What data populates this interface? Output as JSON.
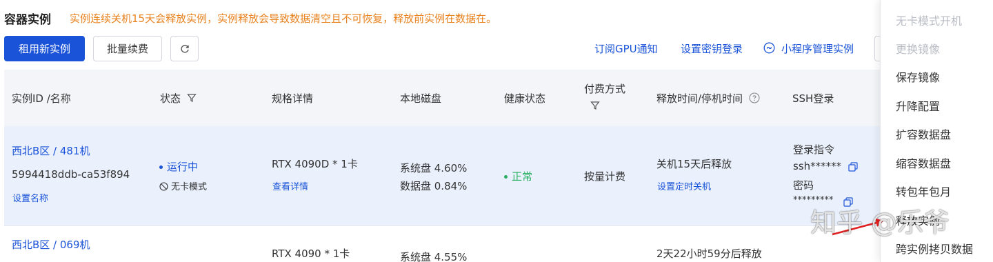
{
  "header": {
    "title": "容器实例",
    "notice": "实例连续关机15天会释放实例，实例释放会导致数据清空且不可恢复，释放前实例在数据在。"
  },
  "toolbar": {
    "rent_button": "租用新实例",
    "renew_button": "批量续费",
    "refresh_icon": "refresh-icon",
    "links": {
      "gpu_notify": "订阅GPU通知",
      "ssh_key_login": "设置密钥登录",
      "mini_program": "小程序管理实例"
    }
  },
  "table": {
    "headers": {
      "id_name": "实例ID /名称",
      "status": "状态",
      "spec": "规格详情",
      "disk": "本地磁盘",
      "health": "健康状态",
      "billing_line1": "付费方式",
      "release_time": "释放时间/停机时间",
      "ssh": "SSH登录"
    },
    "rows": [
      {
        "region": "西北B区 / 481机",
        "instance_id": "5994418ddb-ca53f894",
        "set_name": "设置名称",
        "status": "运行中",
        "mode": "无卡模式",
        "spec": "RTX 4090D * 1卡",
        "spec_link": "查看详情",
        "system_disk": "系统盘 4.60%",
        "data_disk": "数据盘 0.84%",
        "health": "正常",
        "billing": "按量计费",
        "release": "关机15天后释放",
        "release_link": "设置定时关机",
        "ssh_cmd_label": "登录指令",
        "ssh_cmd": "ssh******",
        "password_label": "密码",
        "password": "*********"
      },
      {
        "region": "西北B区 / 069机",
        "spec": "RTX 4090 * 1卡",
        "system_disk": "系统盘 4.55%",
        "release": "2天22小时59分后释放"
      }
    ]
  },
  "menu": {
    "items": [
      {
        "label": "无卡模式开机",
        "disabled": true
      },
      {
        "label": "更换镜像",
        "disabled": true
      },
      {
        "label": "保存镜像",
        "disabled": false
      },
      {
        "label": "升降配置",
        "disabled": false
      },
      {
        "label": "扩容数据盘",
        "disabled": false
      },
      {
        "label": "缩容数据盘",
        "disabled": false
      },
      {
        "label": "转包年包月",
        "disabled": false
      },
      {
        "label": "释放实例",
        "disabled": false
      },
      {
        "label": "跨实例拷贝数据",
        "disabled": false
      }
    ]
  },
  "watermark": "知乎 @乐爷",
  "colors": {
    "primary": "#1a53d8",
    "notice": "#e8821e",
    "healthy": "#27ae60",
    "row_highlight": "#eaf1fd",
    "header_bg": "#f3f5f8"
  }
}
